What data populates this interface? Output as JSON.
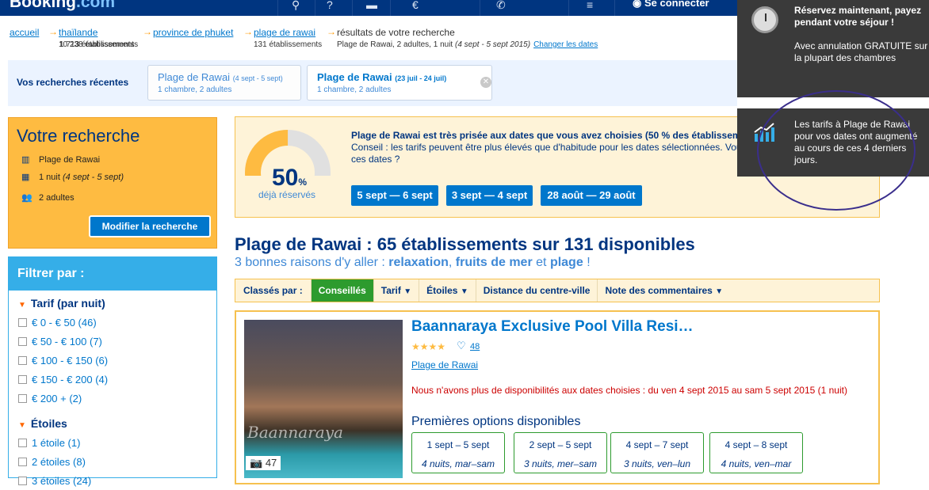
{
  "header": {
    "logo_main": "Booking",
    "logo_dot": ".com",
    "login_label": "Se connecter"
  },
  "breadcrumb": [
    {
      "label": "accueil",
      "sub": "10 238 établissements"
    },
    {
      "label": "thaïlande",
      "sub": "1 713 établissements"
    },
    {
      "label": "province de phuket",
      "sub": "131 établissements"
    },
    {
      "label": "plage de rawai",
      "sub": ""
    },
    {
      "label": "résultats de votre recherche",
      "sub": "Plage de Rawai, 2 adultes, 1 nuit",
      "sub_dates": "(4 sept - 5 sept 2015)",
      "change": "Changer les dates"
    }
  ],
  "recent": {
    "title": "Vos recherches récentes",
    "items": [
      {
        "place": "Plage de Rawai",
        "dates": "(4 sept - 5 sept)",
        "details": "1 chambre, 2 adultes"
      },
      {
        "place": "Plage de Rawai",
        "dates": "(23 juil - 24 juil)",
        "details": "1 chambre, 2 adultes"
      }
    ],
    "close": "✕"
  },
  "search": {
    "title": "Votre recherche",
    "destination": "Plage de Rawai",
    "nights": "1 nuit",
    "dates": "(4 sept - 5 sept)",
    "guests": "2 adultes",
    "modify": "Modifier la recherche"
  },
  "filters": {
    "title": "Filtrer par :",
    "price_title": "Tarif (par nuit)",
    "price": [
      "€ 0 - € 50 (46)",
      "€ 50 - € 100 (7)",
      "€ 100 - € 150 (6)",
      "€ 150 - € 200 (4)",
      "€ 200 + (2)"
    ],
    "stars_title": "Étoiles",
    "stars": [
      "1 étoile (1)",
      "2 étoiles (8)",
      "3 étoiles (24)"
    ]
  },
  "tip": {
    "percent": "50",
    "percent_sign": "%",
    "percent_label": "déjà réservés",
    "line1": "Plage de Rawai est très prisée aux dates que vous avez choisies (50 % des établissements sont réservés).",
    "line2": "Conseil : les tarifs peuvent être plus élevés que d'habitude pour les dates sélectionnées. Voulez-vous continuer avec ces dates ?",
    "dates": [
      "5 sept — 6 sept",
      "3 sept — 4 sept",
      "28 août — 29 août"
    ]
  },
  "results": {
    "heading": "Plage de Rawai : 65 établissements sur 131 disponibles",
    "sub_prefix": "3 bonnes raisons d'y aller :",
    "r1": "relaxation",
    "r2": "fruits de mer",
    "r3": "plage",
    "sub_and": "et",
    "sub_end": "!"
  },
  "sort": {
    "label": "Classés par :",
    "options": [
      "Conseillés",
      "Tarif",
      "Étoiles",
      "Distance du centre-ville",
      "Note des commentaires"
    ]
  },
  "hotel": {
    "name": "Baannaraya Exclusive Pool Villa Resi…",
    "stars": "★★★★",
    "reviews": "48",
    "location": "Plage de Rawai",
    "unavailable": "Nous n'avons plus de disponibilités aux dates choisies : du ven 4 sept 2015 au sam 5 sept 2015 (1 nuit)",
    "options_title": "Premières options disponibles",
    "photo_count": "47",
    "watermark": "Baannaraya",
    "options": [
      {
        "dates": "1 sept – 5 sept",
        "nights": "4 nuits, mar–sam"
      },
      {
        "dates": "2 sept – 5 sept",
        "nights": "3 nuits, mer–sam"
      },
      {
        "dates": "4 sept – 7 sept",
        "nights": "3 nuits, ven–lun"
      },
      {
        "dates": "4 sept – 8 sept",
        "nights": "4 nuits, ven–mar"
      }
    ]
  },
  "toast1": {
    "bold": "Réservez maintenant, payez pendant votre séjour !",
    "body": "Avec annulation GRATUITE sur la plupart des chambres"
  },
  "toast2": {
    "body": "Les tarifs à Plage de Rawai pour vos dates ont augmenté au cours de ces 4 derniers jours."
  },
  "colors": {
    "brand": "#003580",
    "accent": "#0077cc",
    "highlight": "#febb41",
    "filter": "#35aee8",
    "success": "#2d9b2e"
  }
}
